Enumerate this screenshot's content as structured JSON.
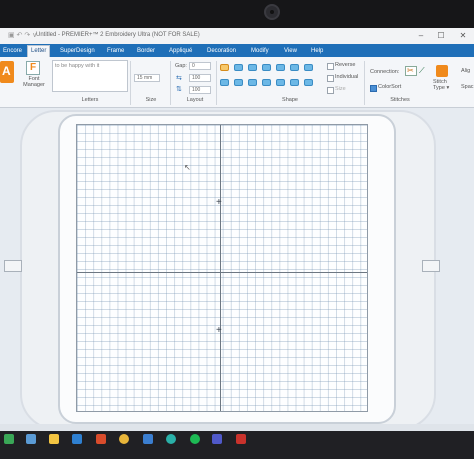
{
  "window": {
    "title": "Untitled - PREMIER+™ 2 Embroidery Ultra (NOT FOR SALE)",
    "qa_icons": "▣ ↶ ↷ ∨"
  },
  "menu": {
    "tabs": [
      {
        "label": "Encore"
      },
      {
        "label": "Letter"
      },
      {
        "label": "SuperDesign"
      },
      {
        "label": "Frame"
      },
      {
        "label": "Border"
      },
      {
        "label": "Appliqué"
      },
      {
        "label": "Decoration"
      },
      {
        "label": "Modify"
      },
      {
        "label": "View"
      },
      {
        "label": "Help"
      }
    ],
    "active_index": 1
  },
  "ribbon": {
    "font_manager_label": "Font Manager",
    "letter_text": "to be happy with it",
    "size_value": "15 mm",
    "gap_label": "Gap:",
    "gap_value": "0",
    "width_pct": "100",
    "height_pct": "100",
    "reverse_label": "Reverse",
    "individual_label": "Individual",
    "size_chk_label": "Size",
    "connection_label": "Connection:",
    "colorsort_label": "ColorSort",
    "stitch_type_label": "Stitch Type ▾",
    "align_label": "Alig",
    "spacing_label": "Spac",
    "groups": {
      "letters": "Letters",
      "size": "Size",
      "layout": "Layout",
      "shape": "Shape",
      "stitches": "Stitches"
    }
  },
  "colors": {
    "accent": "#1f6fb8",
    "ribbon_bg": "#f4f6f9",
    "canvas_bg": "#fdfeff",
    "orange": "#f08a1c"
  },
  "taskbar": {
    "icons": [
      "search-icon",
      "taskview-icon",
      "file-explorer-icon",
      "mail-icon",
      "premier-icon",
      "chrome-icon",
      "store-icon",
      "edge-icon",
      "spotify-icon",
      "teams-icon",
      "app-icon"
    ]
  }
}
